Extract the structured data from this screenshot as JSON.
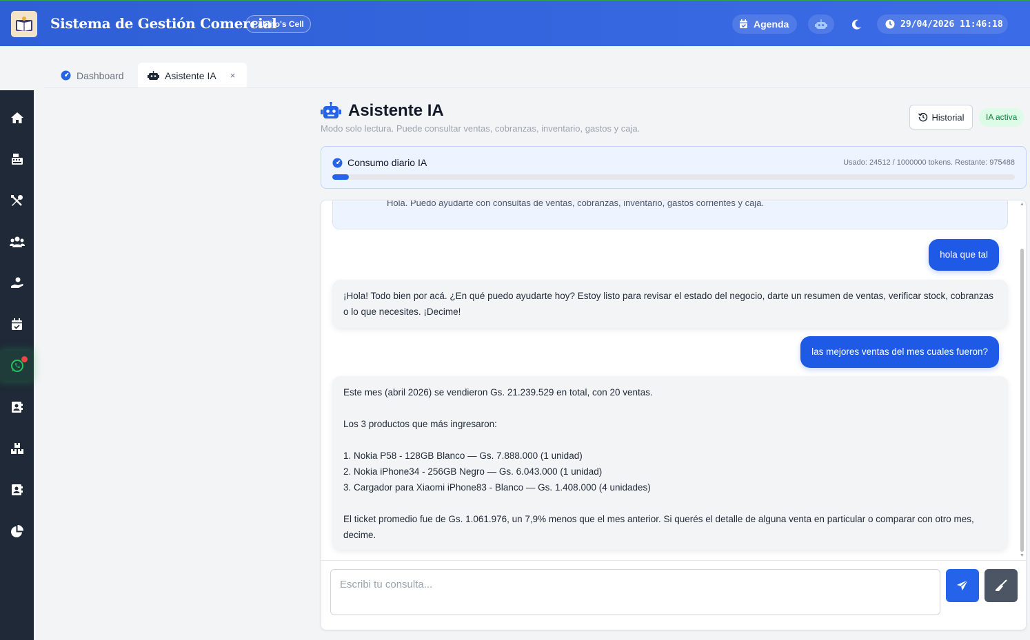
{
  "header": {
    "title": "Sistema de Gestión Comercial",
    "badge": "Pablito's Cell",
    "agenda_label": "Agenda",
    "datetime": "29/04/2026 11:46:18"
  },
  "sidebar": {
    "items": [
      {
        "icon": "home-icon"
      },
      {
        "icon": "cash-register-icon"
      },
      {
        "icon": "tools-icon"
      },
      {
        "icon": "users-icon"
      },
      {
        "icon": "hand-money-icon"
      },
      {
        "icon": "calendar-icon"
      },
      {
        "icon": "whatsapp-icon",
        "notification": true
      },
      {
        "icon": "contact-book-icon"
      },
      {
        "icon": "boxes-icon"
      },
      {
        "icon": "address-book-icon"
      },
      {
        "icon": "pie-chart-icon"
      }
    ]
  },
  "tabs": [
    {
      "label": "Dashboard",
      "icon": "gauge-icon",
      "active": false
    },
    {
      "label": "Asistente IA",
      "icon": "robot-icon",
      "active": true,
      "close": "×"
    }
  ],
  "page": {
    "title": "Asistente IA",
    "subtitle": "Modo solo lectura. Puede consultar ventas, cobranzas, inventario, gastos y caja.",
    "historial_label": "Historial",
    "status_badge": "IA activa"
  },
  "consumo": {
    "title": "Consumo diario IA",
    "usage_text": "Usado: 24512 / 1000000 tokens. Restante: 975488",
    "used_fraction": 0.0245
  },
  "chat": {
    "previous_partial": "Hola. Puedo ayudarte con consultas de ventas, cobranzas, inventario, gastos corrientes y caja.",
    "messages": [
      {
        "role": "user",
        "text": "hola que tal"
      },
      {
        "role": "assistant",
        "lines": [
          "¡Hola! Todo bien por acá. ¿En qué puedo ayudarte hoy? Estoy listo para revisar el estado del negocio, darte un resumen de ventas, verificar stock, cobranzas o lo que necesites. ¡Decime!"
        ]
      },
      {
        "role": "user",
        "text": "las mejores ventas del mes cuales fueron?"
      },
      {
        "role": "assistant",
        "lines": [
          "Este mes (abril 2026) se vendieron Gs. 21.239.529 en total, con 20 ventas.",
          "",
          "Los 3 productos que más ingresaron:",
          "",
          "1. Nokia P58 - 128GB Blanco — Gs. 7.888.000 (1 unidad)",
          "2. Nokia iPhone34 - 256GB Negro — Gs. 6.043.000 (1 unidad)",
          "3. Cargador para Xiaomi iPhone83 - Blanco — Gs. 1.408.000 (4 unidades)",
          "",
          "El ticket promedio fue de Gs. 1.061.976, un 7,9% menos que el mes anterior. Si querés el detalle de alguna venta en particular o comparar con otro mes, decime."
        ]
      }
    ],
    "input_placeholder": "Escribi tu consulta...",
    "input_value": ""
  },
  "colors": {
    "header": "#3b6be6",
    "sidebar": "#1f2937",
    "accent": "#2563eb",
    "user_bubble": "#1e5ae6",
    "status_green": "#15803d"
  }
}
